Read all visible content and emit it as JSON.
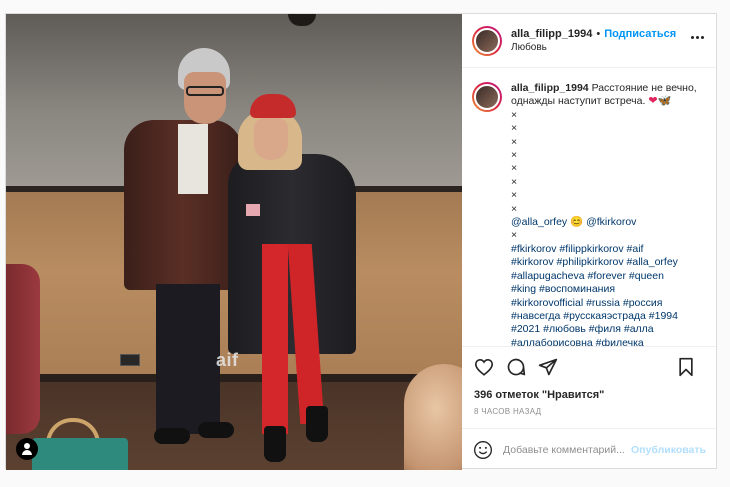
{
  "header": {
    "username": "alla_filipp_1994",
    "separator": "•",
    "follow_label": "Подписаться",
    "location": "Любовь"
  },
  "photo": {
    "watermark": "aif"
  },
  "caption": {
    "username": "alla_filipp_1994",
    "text_line1": "Расстояние не вечно,",
    "text_line2": "однажды наступит встреча.",
    "emoji_heart": "❤",
    "emoji_butterfly": "🦋",
    "separators": [
      "×",
      "×",
      "×",
      "×",
      "×",
      "×",
      "×",
      "×"
    ],
    "mentions": "@alla_orfey 😊 @fkirkorov",
    "separator_after": "×",
    "hashtag_lines": [
      "#fkirkorov #filippkirkorov #aif",
      "#kirkorov #philipkirkorov #alla_orfey",
      "#allapugacheva #forever #queen",
      "#king #воспоминания",
      "#kirkorovofficial #russia #россия",
      "#навсегда #русскаяэстрада #1994",
      "#2021 #любовь #филя #алла",
      "#аллаборисовна #филечка"
    ]
  },
  "stats": {
    "likes": "396 отметок \"Нравится\"",
    "time": "8 ЧАСОВ НАЗАД"
  },
  "comment_box": {
    "placeholder": "Добавьте комментарий...",
    "publish_label": "Опубликовать"
  },
  "icons": {
    "like": "heart-outline-icon",
    "comment": "comment-bubble-icon",
    "share": "paper-plane-icon",
    "save": "bookmark-icon",
    "emoji": "smiley-icon",
    "more": "more-horizontal-icon",
    "user_tag": "user-tag-icon"
  },
  "colors": {
    "link_blue": "#0095f6",
    "publish_disabled": "#b2dffc",
    "hashtag": "#00376b"
  }
}
